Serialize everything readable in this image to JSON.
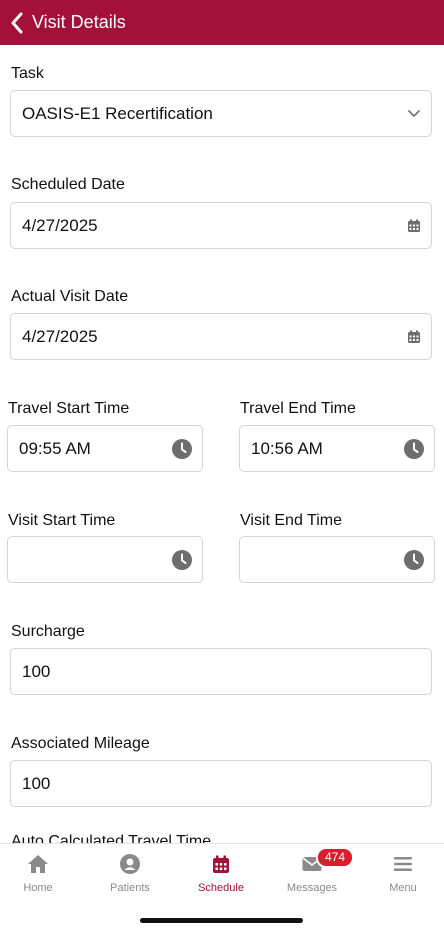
{
  "header": {
    "title": "Visit Details"
  },
  "form": {
    "task_label": "Task",
    "task_value": "OASIS-E1 Recertification",
    "scheduled_date_label": "Scheduled Date",
    "scheduled_date_value": "4/27/2025",
    "actual_visit_date_label": "Actual Visit Date",
    "actual_visit_date_value": "4/27/2025",
    "travel_start_label": "Travel Start Time",
    "travel_start_value": "09:55 AM",
    "travel_end_label": "Travel End Time",
    "travel_end_value": "10:56 AM",
    "visit_start_label": "Visit Start Time",
    "visit_start_value": "",
    "visit_end_label": "Visit End Time",
    "visit_end_value": "",
    "surcharge_label": "Surcharge",
    "surcharge_value": "100",
    "mileage_label": "Associated Mileage",
    "mileage_value": "100",
    "auto_travel_label": "Auto Calculated Travel Time"
  },
  "tabbar": {
    "home": "Home",
    "patients": "Patients",
    "schedule": "Schedule",
    "messages": "Messages",
    "messages_badge": "474",
    "menu": "Menu",
    "active": "Schedule"
  },
  "colors": {
    "brand": "#a3113a",
    "badge": "#d81e2c",
    "inactive": "#8a8a8a"
  },
  "icons": [
    "chevron-left-icon",
    "chevron-down-icon",
    "calendar-icon",
    "clock-icon",
    "home-icon",
    "user-circle-icon",
    "schedule-calendar-icon",
    "envelope-icon",
    "hamburger-menu-icon"
  ]
}
